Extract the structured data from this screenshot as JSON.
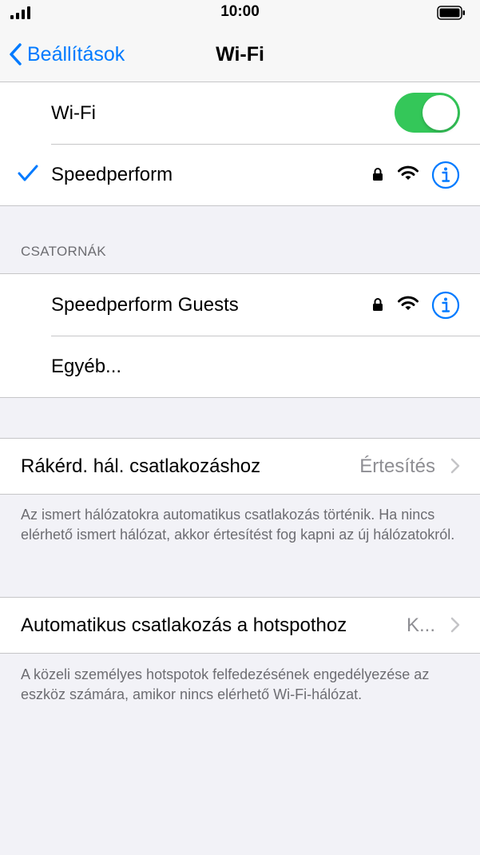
{
  "status_bar": {
    "time": "10:00"
  },
  "nav": {
    "back_label": "Beállítások",
    "title": "Wi-Fi"
  },
  "wifi": {
    "toggle_label": "Wi-Fi",
    "enabled": true,
    "connected_network": "Speedperform"
  },
  "channels": {
    "header": "CSATORNÁK",
    "networks": [
      "Speedperform Guests"
    ],
    "other_label": "Egyéb..."
  },
  "ask_to_join": {
    "label": "Rákérd. hál. csatlakozáshoz",
    "value": "Értesítés",
    "footer": "Az ismert hálózatokra automatikus csatlakozás történik. Ha nincs elérhető ismert hálózat, akkor értesítést fog kapni az új hálózatokról."
  },
  "auto_join_hotspot": {
    "label": "Automatikus csatlakozás a hotspothoz",
    "value": "K...",
    "footer": "A közeli személyes hotspotok felfedezésének engedélyezése az eszköz számára, amikor nincs elérhető Wi-Fi-hálózat."
  },
  "colors": {
    "accent": "#007aff",
    "toggle_on": "#34c759",
    "background": "#f2f2f7",
    "secondary_text": "#6d6d72"
  },
  "icons": [
    "signal-icon",
    "battery-icon",
    "back-chevron-icon",
    "checkmark-icon",
    "lock-icon",
    "wifi-icon",
    "info-icon",
    "chevron-right-icon"
  ]
}
